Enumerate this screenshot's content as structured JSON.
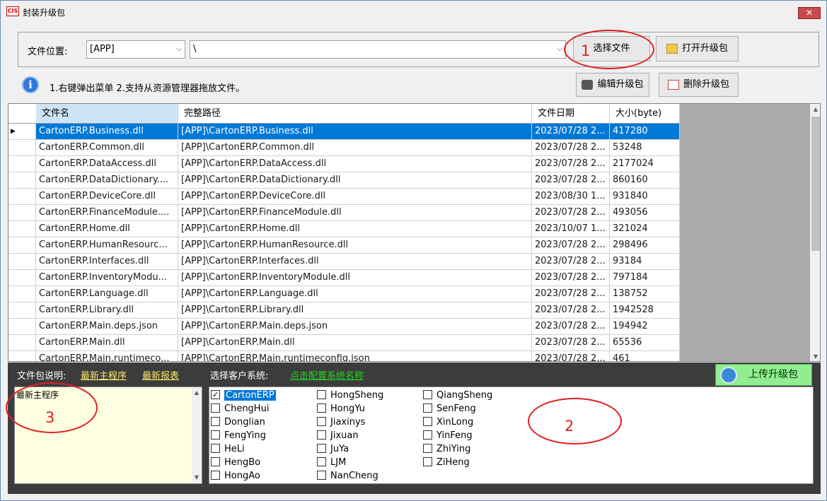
{
  "window": {
    "title": "封装升级包",
    "logo": "CIS"
  },
  "toolbar": {
    "location_label": "文件位置:",
    "location_value": "[APP]",
    "path_value": "\\",
    "select_file_label": "选择文件",
    "open_package_label": "打开升级包",
    "edit_package_label": "编辑升级包",
    "delete_package_label": "删除升级包",
    "hint": "1.右键弹出菜单 2.支持从资源管理器拖放文件。"
  },
  "annotations": {
    "num1": "1",
    "num2": "2",
    "num3": "3"
  },
  "grid": {
    "columns": [
      "文件名",
      "完整路径",
      "文件日期",
      "大小(byte)"
    ],
    "rows": [
      [
        "CartonERP.Business.dll",
        "[APP]\\CartonERP.Business.dll",
        "2023/07/28 2...",
        "417280"
      ],
      [
        "CartonERP.Common.dll",
        "[APP]\\CartonERP.Common.dll",
        "2023/07/28 2...",
        "53248"
      ],
      [
        "CartonERP.DataAccess.dll",
        "[APP]\\CartonERP.DataAccess.dll",
        "2023/07/28 2...",
        "2177024"
      ],
      [
        "CartonERP.DataDictionary....",
        "[APP]\\CartonERP.DataDictionary.dll",
        "2023/07/28 2...",
        "860160"
      ],
      [
        "CartonERP.DeviceCore.dll",
        "[APP]\\CartonERP.DeviceCore.dll",
        "2023/08/30 1...",
        "931840"
      ],
      [
        "CartonERP.FinanceModule....",
        "[APP]\\CartonERP.FinanceModule.dll",
        "2023/07/28 2...",
        "493056"
      ],
      [
        "CartonERP.Home.dll",
        "[APP]\\CartonERP.Home.dll",
        "2023/10/07 1...",
        "321024"
      ],
      [
        "CartonERP.HumanResourc...",
        "[APP]\\CartonERP.HumanResource.dll",
        "2023/07/28 2...",
        "298496"
      ],
      [
        "CartonERP.Interfaces.dll",
        "[APP]\\CartonERP.Interfaces.dll",
        "2023/07/28 2...",
        "93184"
      ],
      [
        "CartonERP.InventoryModu...",
        "[APP]\\CartonERP.InventoryModule.dll",
        "2023/07/28 2...",
        "797184"
      ],
      [
        "CartonERP.Language.dll",
        "[APP]\\CartonERP.Language.dll",
        "2023/07/28 2...",
        "138752"
      ],
      [
        "CartonERP.Library.dll",
        "[APP]\\CartonERP.Library.dll",
        "2023/07/28 2...",
        "1942528"
      ],
      [
        "CartonERP.Main.deps.json",
        "[APP]\\CartonERP.Main.deps.json",
        "2023/07/28 2...",
        "194942"
      ],
      [
        "CartonERP.Main.dll",
        "[APP]\\CartonERP.Main.dll",
        "2023/07/28 2...",
        "65536"
      ],
      [
        "CartonERP.Main.runtimeco...",
        "[APP]\\CartonERP.Main.runtimeconfig.json",
        "2023/07/28 2...",
        "461"
      ]
    ]
  },
  "bottom": {
    "desc_label": "文件包说明:",
    "link_main": "最新主程序",
    "link_report": "最新报表",
    "client_label": "选择客户系统:",
    "config_link": "点击配置系统名称",
    "upload_label": "上传升级包",
    "desc_text": "最新主程序"
  },
  "clients": [
    [
      "CartonERP",
      "ChengHui",
      "Donglian",
      "FengYing",
      "HeLi",
      "HengBo",
      "HongAo"
    ],
    [
      "HongSheng",
      "HongYu",
      "Jiaxinys",
      "Jixuan",
      "JuYa",
      "LJM",
      "NanCheng"
    ],
    [
      "QiangSheng",
      "SenFeng",
      "XinLong",
      "YinFeng",
      "ZhiYing",
      "ZiHeng"
    ]
  ],
  "checked_client": "CartonERP"
}
